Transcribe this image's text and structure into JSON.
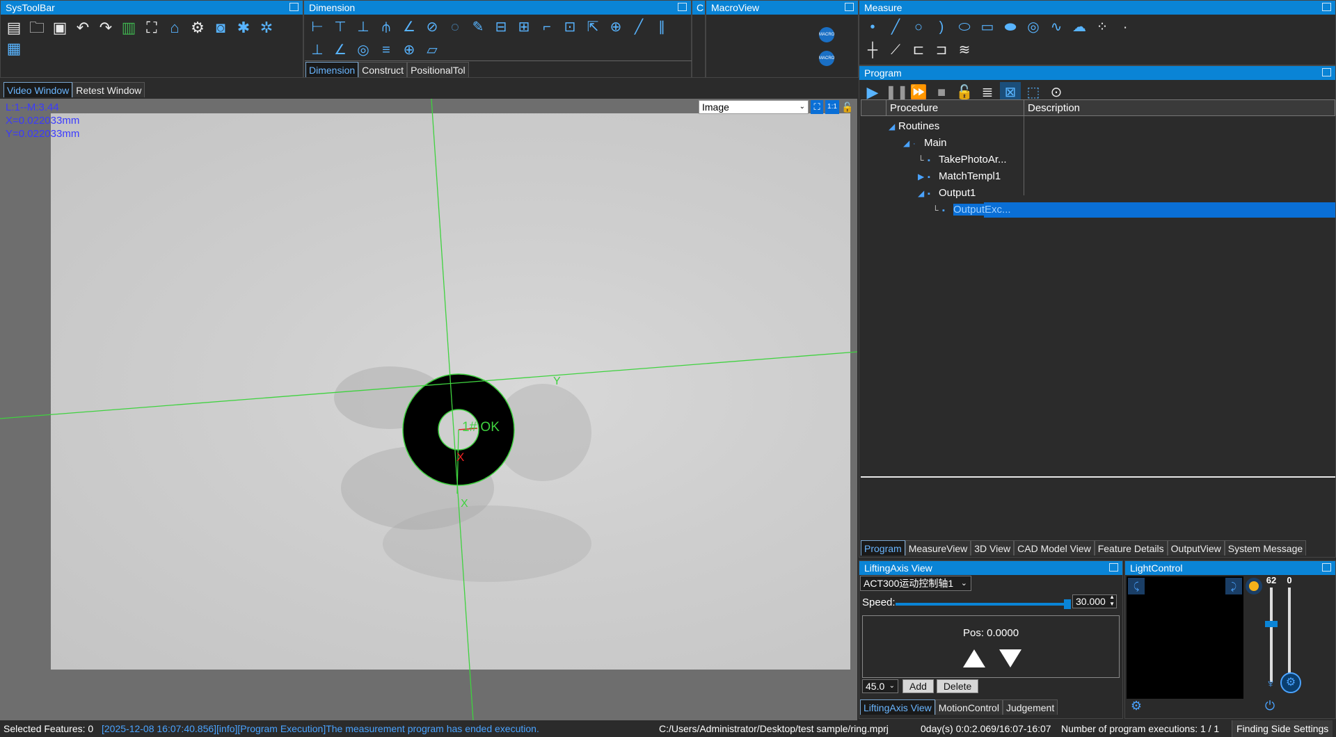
{
  "systoolbar": {
    "title": "SysToolBar",
    "icons": [
      "new-program-icon",
      "open-folder-icon",
      "save-icon",
      "undo-icon",
      "redo-icon",
      "excel-icon",
      "fit-screen-icon",
      "home-icon",
      "settings-gear-icon",
      "camera-icon",
      "plugin-icon",
      "plugins-icon",
      "grid-icon"
    ]
  },
  "dimension": {
    "title": "Dimension",
    "icons_row1": [
      "dim-xy-icon",
      "dim-x-icon",
      "dim-y-icon",
      "dim-height-icon",
      "dim-angle-icon",
      "dim-diameter-icon",
      "dim-radius-icon",
      "dim-edit-icon",
      "dim-h-distance-icon",
      "dim-v-distance-icon",
      "dim-step-icon",
      "dim-box-icon",
      "dim-select-icon",
      "dim-crosshair-icon",
      "dim-line-icon",
      "dim-parallel-icon"
    ],
    "icons_row2": [
      "perpendicular-icon",
      "angle-icon",
      "concentric-icon",
      "symmetry-icon",
      "position-icon",
      "flatness-icon"
    ],
    "tabs": [
      "Dimension",
      "Construct",
      "PositionalTol"
    ]
  },
  "macroview": {
    "title": "MacroView",
    "buttons": [
      "MACRO",
      "MACRO"
    ]
  },
  "measure": {
    "title": "Measure",
    "icons_row1": [
      "point-icon",
      "line-icon",
      "circle-icon",
      "arc-icon",
      "ellipse-icon",
      "rectangle-icon",
      "slot-icon",
      "ring-icon",
      "curve-icon",
      "blob-icon",
      "point-cloud-icon",
      "focus-point-icon"
    ],
    "icons_row2": [
      "cross-icon",
      "edge-icon",
      "width-icon",
      "height-measure-icon",
      "thread-icon"
    ]
  },
  "video": {
    "tabs": [
      "Video Window",
      "Retest Window"
    ],
    "overlay": [
      "L:1--M:3.44",
      "X=0.022033mm",
      "Y=0.022033mm"
    ],
    "image_select": "Image",
    "zoom_label": "1:1",
    "feature_label": "1# OK",
    "axis_x": "X",
    "axis_y": "Y"
  },
  "program": {
    "title": "Program",
    "columns": [
      "Procedure",
      "Description"
    ],
    "tree": [
      {
        "label": "Routines",
        "level": 0,
        "expander": "open"
      },
      {
        "label": "Main",
        "level": 1,
        "expander": "open"
      },
      {
        "label": "TakePhotoAr...",
        "level": 2,
        "expander": "none"
      },
      {
        "label": "MatchTempl1",
        "level": 2,
        "expander": "closed"
      },
      {
        "label": "Output1",
        "level": 2,
        "expander": "open"
      },
      {
        "label": "OutputExc...",
        "level": 3,
        "expander": "none",
        "selected": true
      }
    ],
    "bottom_tabs": [
      "Program",
      "MeasureView",
      "3D View",
      "CAD Model View",
      "Feature Details",
      "OutputView",
      "System Message"
    ]
  },
  "lifting": {
    "title": "LiftingAxis View",
    "axis_select": "ACT300运动控制轴1",
    "speed_label": "Speed:",
    "speed_value": "30.000",
    "speed_fraction": 0.98,
    "pos_label": "Pos: 0.0000",
    "step_select": "45.0",
    "add_label": "Add",
    "delete_label": "Delete",
    "tabs": [
      "LiftingAxis View",
      "MotionControl",
      "Judgement"
    ]
  },
  "light": {
    "title": "LightControl",
    "value_a": "62",
    "value_b": "0",
    "fraction_a": 0.62,
    "fraction_b": 0.0
  },
  "status": {
    "selected": "Selected Features: 0",
    "log": "[2025-12-08 16:07:40.856][info][Program Execution]The measurement program has ended execution.",
    "path": "C:/Users/Administrator/Desktop/test sample/ring.mprj",
    "time": "0day(s) 0:0:2.069/16:07-16:07",
    "exec": "Number of program executions: 1 / 1",
    "finding": "Finding Side Settings"
  },
  "colors": {
    "accent": "#0a84d6",
    "selection": "#0a6fd6",
    "overlay_text": "#3a3aff",
    "crosshair": "#3fd23f",
    "log_text": "#4aa3ff"
  }
}
